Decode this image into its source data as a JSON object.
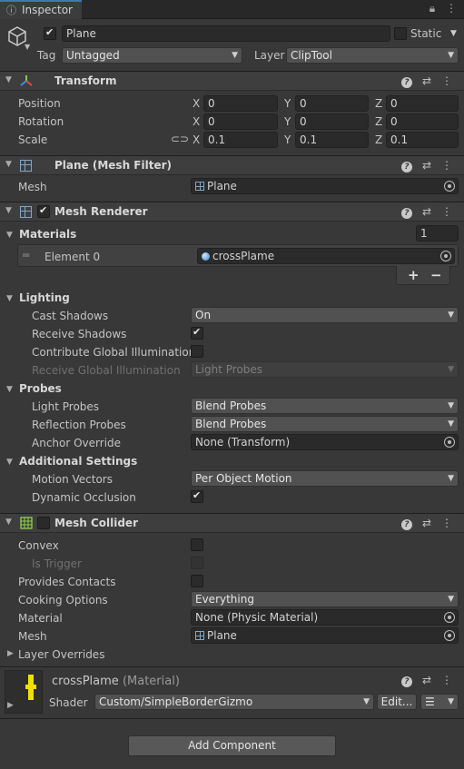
{
  "tab": {
    "title": "Inspector"
  },
  "object": {
    "name": "Plane",
    "active": true,
    "static_label": "Static",
    "tag_label": "Tag",
    "tag_value": "Untagged",
    "layer_label": "Layer",
    "layer_value": "ClipTool"
  },
  "transform": {
    "title": "Transform",
    "position_label": "Position",
    "rotation_label": "Rotation",
    "scale_label": "Scale",
    "axis_x": "X",
    "axis_y": "Y",
    "axis_z": "Z",
    "position": {
      "x": "0",
      "y": "0",
      "z": "0"
    },
    "rotation": {
      "x": "0",
      "y": "0",
      "z": "0"
    },
    "scale": {
      "x": "0.1",
      "y": "0.1",
      "z": "0.1"
    }
  },
  "mesh_filter": {
    "title": "Plane (Mesh Filter)",
    "mesh_label": "Mesh",
    "mesh_value": "Plane"
  },
  "mesh_renderer": {
    "title": "Mesh Renderer",
    "enabled": true,
    "materials_label": "Materials",
    "materials_count": "1",
    "element0_label": "Element 0",
    "element0_value": "crossPlame",
    "add_label": "+",
    "remove_label": "−",
    "lighting_label": "Lighting",
    "cast_shadows_label": "Cast Shadows",
    "cast_shadows_value": "On",
    "receive_shadows_label": "Receive Shadows",
    "contribute_gi_label": "Contribute Global Illumination",
    "receive_gi_label": "Receive Global Illumination",
    "receive_gi_value": "Light Probes",
    "probes_label": "Probes",
    "light_probes_label": "Light Probes",
    "light_probes_value": "Blend Probes",
    "reflection_probes_label": "Reflection Probes",
    "reflection_probes_value": "Blend Probes",
    "anchor_override_label": "Anchor Override",
    "anchor_override_value": "None (Transform)",
    "additional_label": "Additional Settings",
    "motion_vectors_label": "Motion Vectors",
    "motion_vectors_value": "Per Object Motion",
    "dynamic_occlusion_label": "Dynamic Occlusion"
  },
  "mesh_collider": {
    "title": "Mesh Collider",
    "convex_label": "Convex",
    "is_trigger_label": "Is Trigger",
    "provides_contacts_label": "Provides Contacts",
    "cooking_options_label": "Cooking Options",
    "cooking_options_value": "Everything",
    "material_label": "Material",
    "material_value": "None (Physic Material)",
    "mesh_label": "Mesh",
    "mesh_value": "Plane",
    "layer_overrides_label": "Layer Overrides"
  },
  "material": {
    "name": "crossPlame",
    "kind": "(Material)",
    "shader_label": "Shader",
    "shader_value": "Custom/SimpleBorderGizmo",
    "edit_label": "Edit..."
  },
  "add_component_label": "Add Component"
}
